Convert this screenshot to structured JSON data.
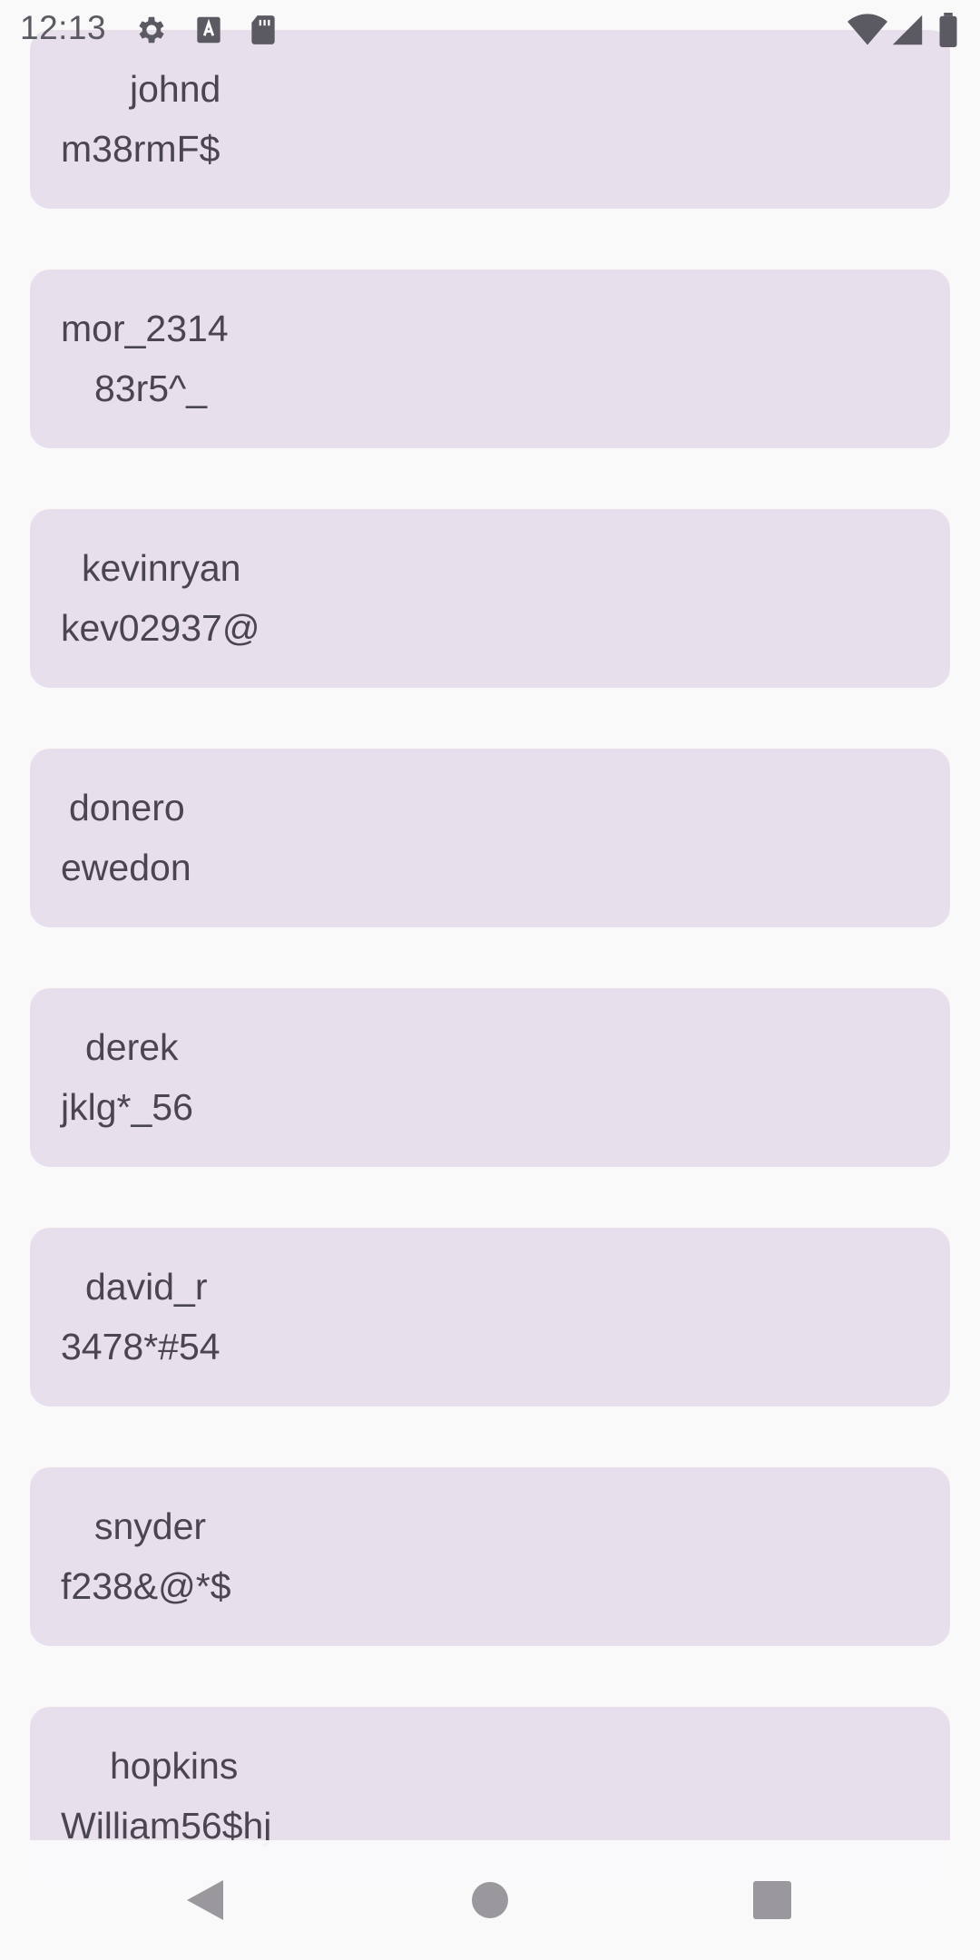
{
  "status_bar": {
    "time": "12:13",
    "icons": [
      "gear-icon",
      "font-a-icon",
      "sd-card-icon",
      "wifi-icon",
      "signal-icon",
      "battery-icon"
    ]
  },
  "accounts": [
    {
      "username": "johnd",
      "password": "m38rmF$"
    },
    {
      "username": "mor_2314",
      "password": "83r5^_"
    },
    {
      "username": "kevinryan",
      "password": "kev02937@"
    },
    {
      "username": "donero",
      "password": "ewedon"
    },
    {
      "username": "derek",
      "password": "jklg*_56"
    },
    {
      "username": "david_r",
      "password": "3478*#54"
    },
    {
      "username": "snyder",
      "password": "f238&@*$"
    },
    {
      "username": "hopkins",
      "password": "William56$hj"
    }
  ],
  "nav_bar": {
    "buttons": [
      "back-icon",
      "home-icon",
      "recents-icon"
    ]
  },
  "colors": {
    "card_background": "#E7DFEB",
    "page_background": "#FAF9FA",
    "text": "#4a4650"
  }
}
